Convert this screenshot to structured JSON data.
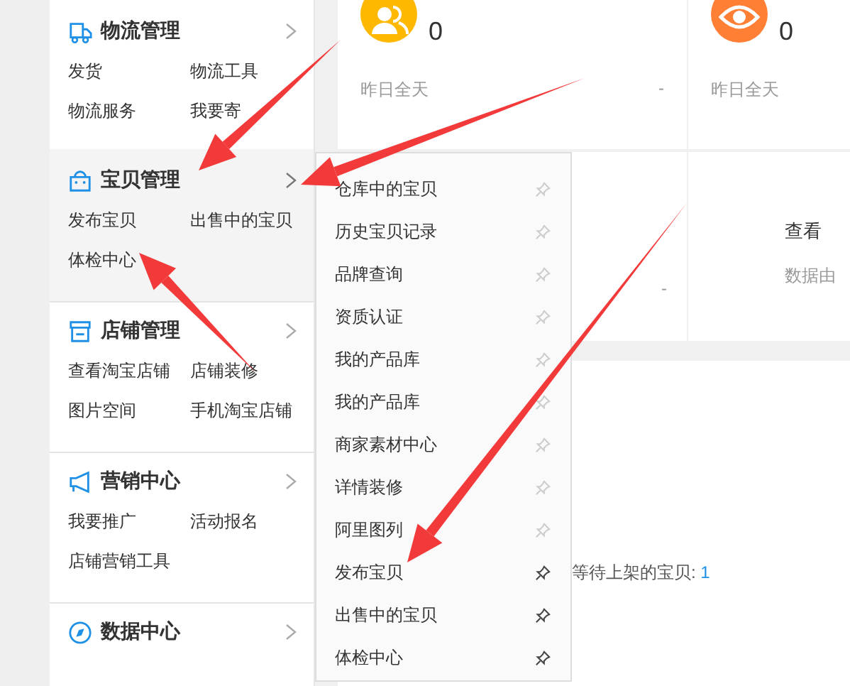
{
  "sidebar": {
    "sections": [
      {
        "title": "物流管理",
        "kind": "truck",
        "selected": false,
        "links": [
          "发货",
          "物流工具",
          "物流服务",
          "我要寄"
        ]
      },
      {
        "title": "宝贝管理",
        "kind": "bag",
        "selected": true,
        "links": [
          "发布宝贝",
          "出售中的宝贝",
          "体检中心"
        ]
      },
      {
        "title": "店铺管理",
        "kind": "shop",
        "selected": false,
        "links": [
          "查看淘宝店铺",
          "店铺装修",
          "图片空间",
          "手机淘宝店铺"
        ]
      },
      {
        "title": "营销中心",
        "kind": "megaphone",
        "selected": false,
        "links": [
          "我要推广",
          "活动报名",
          "店铺营销工具"
        ]
      },
      {
        "title": "数据中心",
        "kind": "compass",
        "selected": false
      }
    ]
  },
  "stats": [
    {
      "kind": "buyers",
      "value": "0",
      "period": "昨日全天",
      "change": "-"
    },
    {
      "kind": "views",
      "value": "0",
      "period": "昨日全天"
    }
  ],
  "stats_row_2": [
    {
      "change": "-"
    },
    {
      "link": "查看",
      "note": "数据由"
    }
  ],
  "panel": {
    "label": "等待上架的宝贝: ",
    "count": "1"
  },
  "flyout": {
    "items": [
      {
        "label": "仓库中的宝贝",
        "pinned": false
      },
      {
        "label": "历史宝贝记录",
        "pinned": false
      },
      {
        "label": "品牌查询",
        "pinned": false
      },
      {
        "label": "资质认证",
        "pinned": false
      },
      {
        "label": "我的产品库",
        "pinned": false
      },
      {
        "label": "我的产品库",
        "pinned": false
      },
      {
        "label": "商家素材中心",
        "pinned": false
      },
      {
        "label": "详情装修",
        "pinned": false
      },
      {
        "label": "阿里图列",
        "pinned": false
      },
      {
        "label": "发布宝贝",
        "pinned": true
      },
      {
        "label": "出售中的宝贝",
        "pinned": true
      },
      {
        "label": "体检中心",
        "pinned": true
      }
    ]
  }
}
